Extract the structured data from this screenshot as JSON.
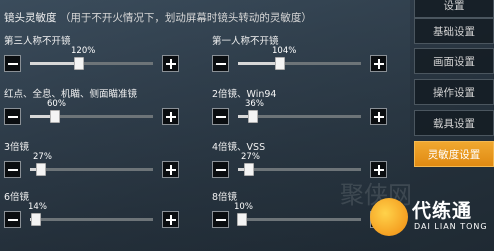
{
  "header": {
    "title": "镜头灵敏度",
    "hint": "（用于不开火情况下，划动屏幕时镜头转动的灵敏度）"
  },
  "settings": [
    {
      "label": "第三人称不开镜",
      "value": "120%",
      "level": 0.4
    },
    {
      "label": "第一人称不开镜",
      "value": "104%",
      "level": 0.345
    },
    {
      "label": "红点、全息、机瞄、侧面瞄准镜",
      "value": "60%",
      "level": 0.2
    },
    {
      "label": "2倍镜、Win94",
      "value": "36%",
      "level": 0.12
    },
    {
      "label": "3倍镜",
      "value": "27%",
      "level": 0.09
    },
    {
      "label": "4倍镜、VSS",
      "value": "27%",
      "level": 0.09
    },
    {
      "label": "6倍镜",
      "value": "14%",
      "level": 0.05
    },
    {
      "label": "8倍镜",
      "value": "10%",
      "level": 0.035
    }
  ],
  "sidebar": {
    "items": [
      {
        "label": "设置"
      },
      {
        "label": "基础设置"
      },
      {
        "label": "画面设置"
      },
      {
        "label": "操作设置"
      },
      {
        "label": "载具设置"
      },
      {
        "label": "灵敏度设置"
      }
    ]
  },
  "watermark": {
    "brand": "代练通",
    "brand_en": "DAI LIAN TONG",
    "faint": "聚侠网"
  },
  "colors": {
    "active_tab": "#e8951e",
    "background": "#2d3a47"
  }
}
